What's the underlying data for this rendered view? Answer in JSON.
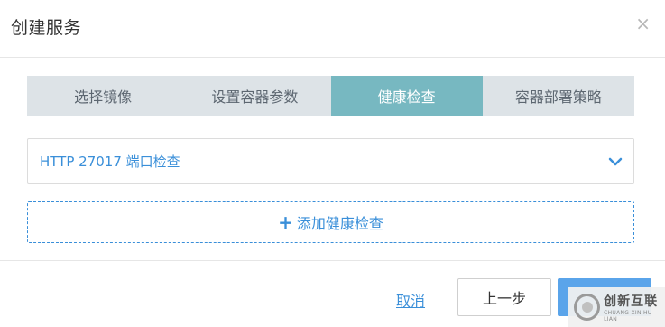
{
  "dialog": {
    "title": "创建服务",
    "close_glyph": "×"
  },
  "steps": [
    {
      "label": "选择镜像",
      "active": false
    },
    {
      "label": "设置容器参数",
      "active": false
    },
    {
      "label": "健康检查",
      "active": true
    },
    {
      "label": "容器部署策略",
      "active": false
    }
  ],
  "health_check": {
    "selected": "HTTP 27017 端口检查",
    "add_label": "添加健康检查",
    "add_icon": "plus-icon"
  },
  "footer": {
    "cancel_label": "取消",
    "prev_label": "上一步",
    "next_label": ""
  },
  "watermark": {
    "text": "创新互联",
    "subtext": "CHUANG XIN HU LIAN"
  },
  "colors": {
    "accent": "#3a8fd9",
    "step_active": "#77b8c1",
    "step_bg": "#dde3e7",
    "primary_button": "#5aa4ea"
  }
}
